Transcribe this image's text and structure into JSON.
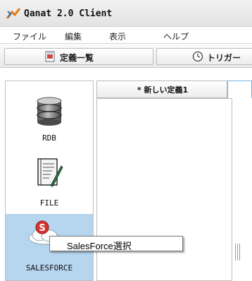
{
  "window": {
    "title": "Qanat 2.0 Client",
    "icon": "qanat-logo-icon"
  },
  "menu": {
    "items": [
      "ファイル",
      "編集",
      "表示",
      "ヘルプ"
    ]
  },
  "toolbar_tabs": [
    {
      "label": "定義一覧",
      "icon": "definition-list-icon"
    },
    {
      "label": "トリガー",
      "icon": "clock-icon"
    }
  ],
  "palette": {
    "items": [
      {
        "label": "RDB",
        "icon": "database-icon"
      },
      {
        "label": "FILE",
        "icon": "file-icon"
      },
      {
        "label": "SALESFORCE",
        "icon": "salesforce-icon",
        "selected": true
      }
    ]
  },
  "editor": {
    "tab_label": "* 新しい定義1"
  },
  "tooltip": {
    "text": "SalesForce選択"
  },
  "colors": {
    "selection": "#b6d5ee",
    "tab_highlight": "#7ab3df"
  }
}
